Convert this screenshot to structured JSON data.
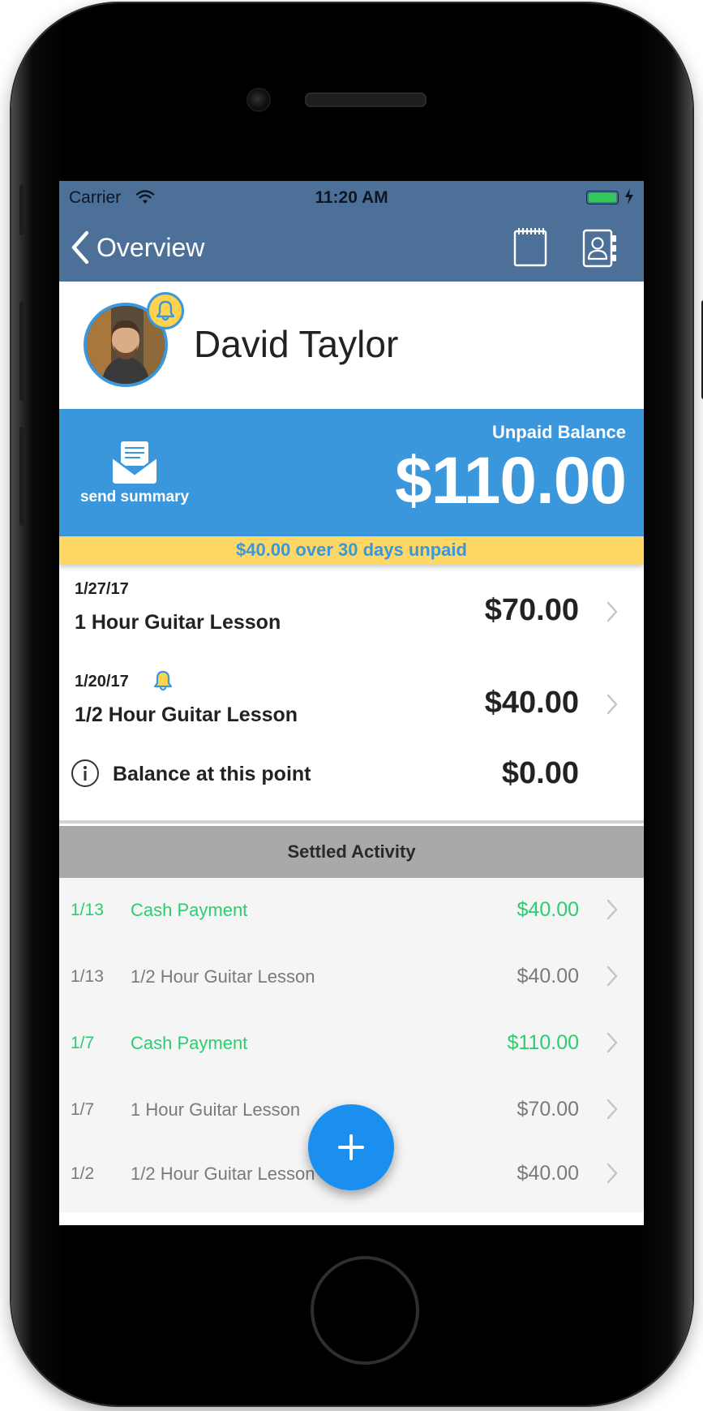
{
  "status_bar": {
    "carrier": "Carrier",
    "time": "11:20 AM"
  },
  "nav": {
    "back_label": "Overview",
    "notebook_icon": "notebook-icon",
    "contacts_icon": "contact-card-icon"
  },
  "profile": {
    "name": "David Taylor",
    "avatar_icon": "avatar-photo",
    "alert_icon": "bell-icon"
  },
  "balance": {
    "send_summary_label": "send summary",
    "unpaid_label": "Unpaid Balance",
    "unpaid_amount": "$110.00",
    "overdue_text": "$40.00 over 30 days unpaid"
  },
  "open_items": [
    {
      "date": "1/27/17",
      "description": "1 Hour Guitar Lesson",
      "amount": "$70.00",
      "alert": false
    },
    {
      "date": "1/20/17",
      "description": "1/2 Hour Guitar Lesson",
      "amount": "$40.00",
      "alert": true
    }
  ],
  "balance_point": {
    "label": "Balance at this point",
    "amount": "$0.00"
  },
  "settled": {
    "header": "Settled Activity",
    "rows": [
      {
        "date": "1/13",
        "description": "Cash Payment",
        "amount": "$40.00",
        "type": "payment"
      },
      {
        "date": "1/13",
        "description": "1/2 Hour Guitar Lesson",
        "amount": "$40.00",
        "type": "charge"
      },
      {
        "date": "1/7",
        "description": "Cash Payment",
        "amount": "$110.00",
        "type": "payment"
      },
      {
        "date": "1/7",
        "description": "1 Hour Guitar Lesson",
        "amount": "$70.00",
        "type": "charge"
      },
      {
        "date": "1/2",
        "description": "1/2 Hour Guitar Lesson",
        "amount": "$40.00",
        "type": "charge"
      }
    ]
  },
  "fab": {
    "icon": "plus-icon"
  },
  "colors": {
    "nav_bar": "#4d7099",
    "balance_banner": "#3a97dc",
    "overdue_banner": "#fed765",
    "payment_green": "#2ecc71",
    "charge_gray": "#7a7a7a",
    "fab_blue": "#1a8ff0"
  }
}
